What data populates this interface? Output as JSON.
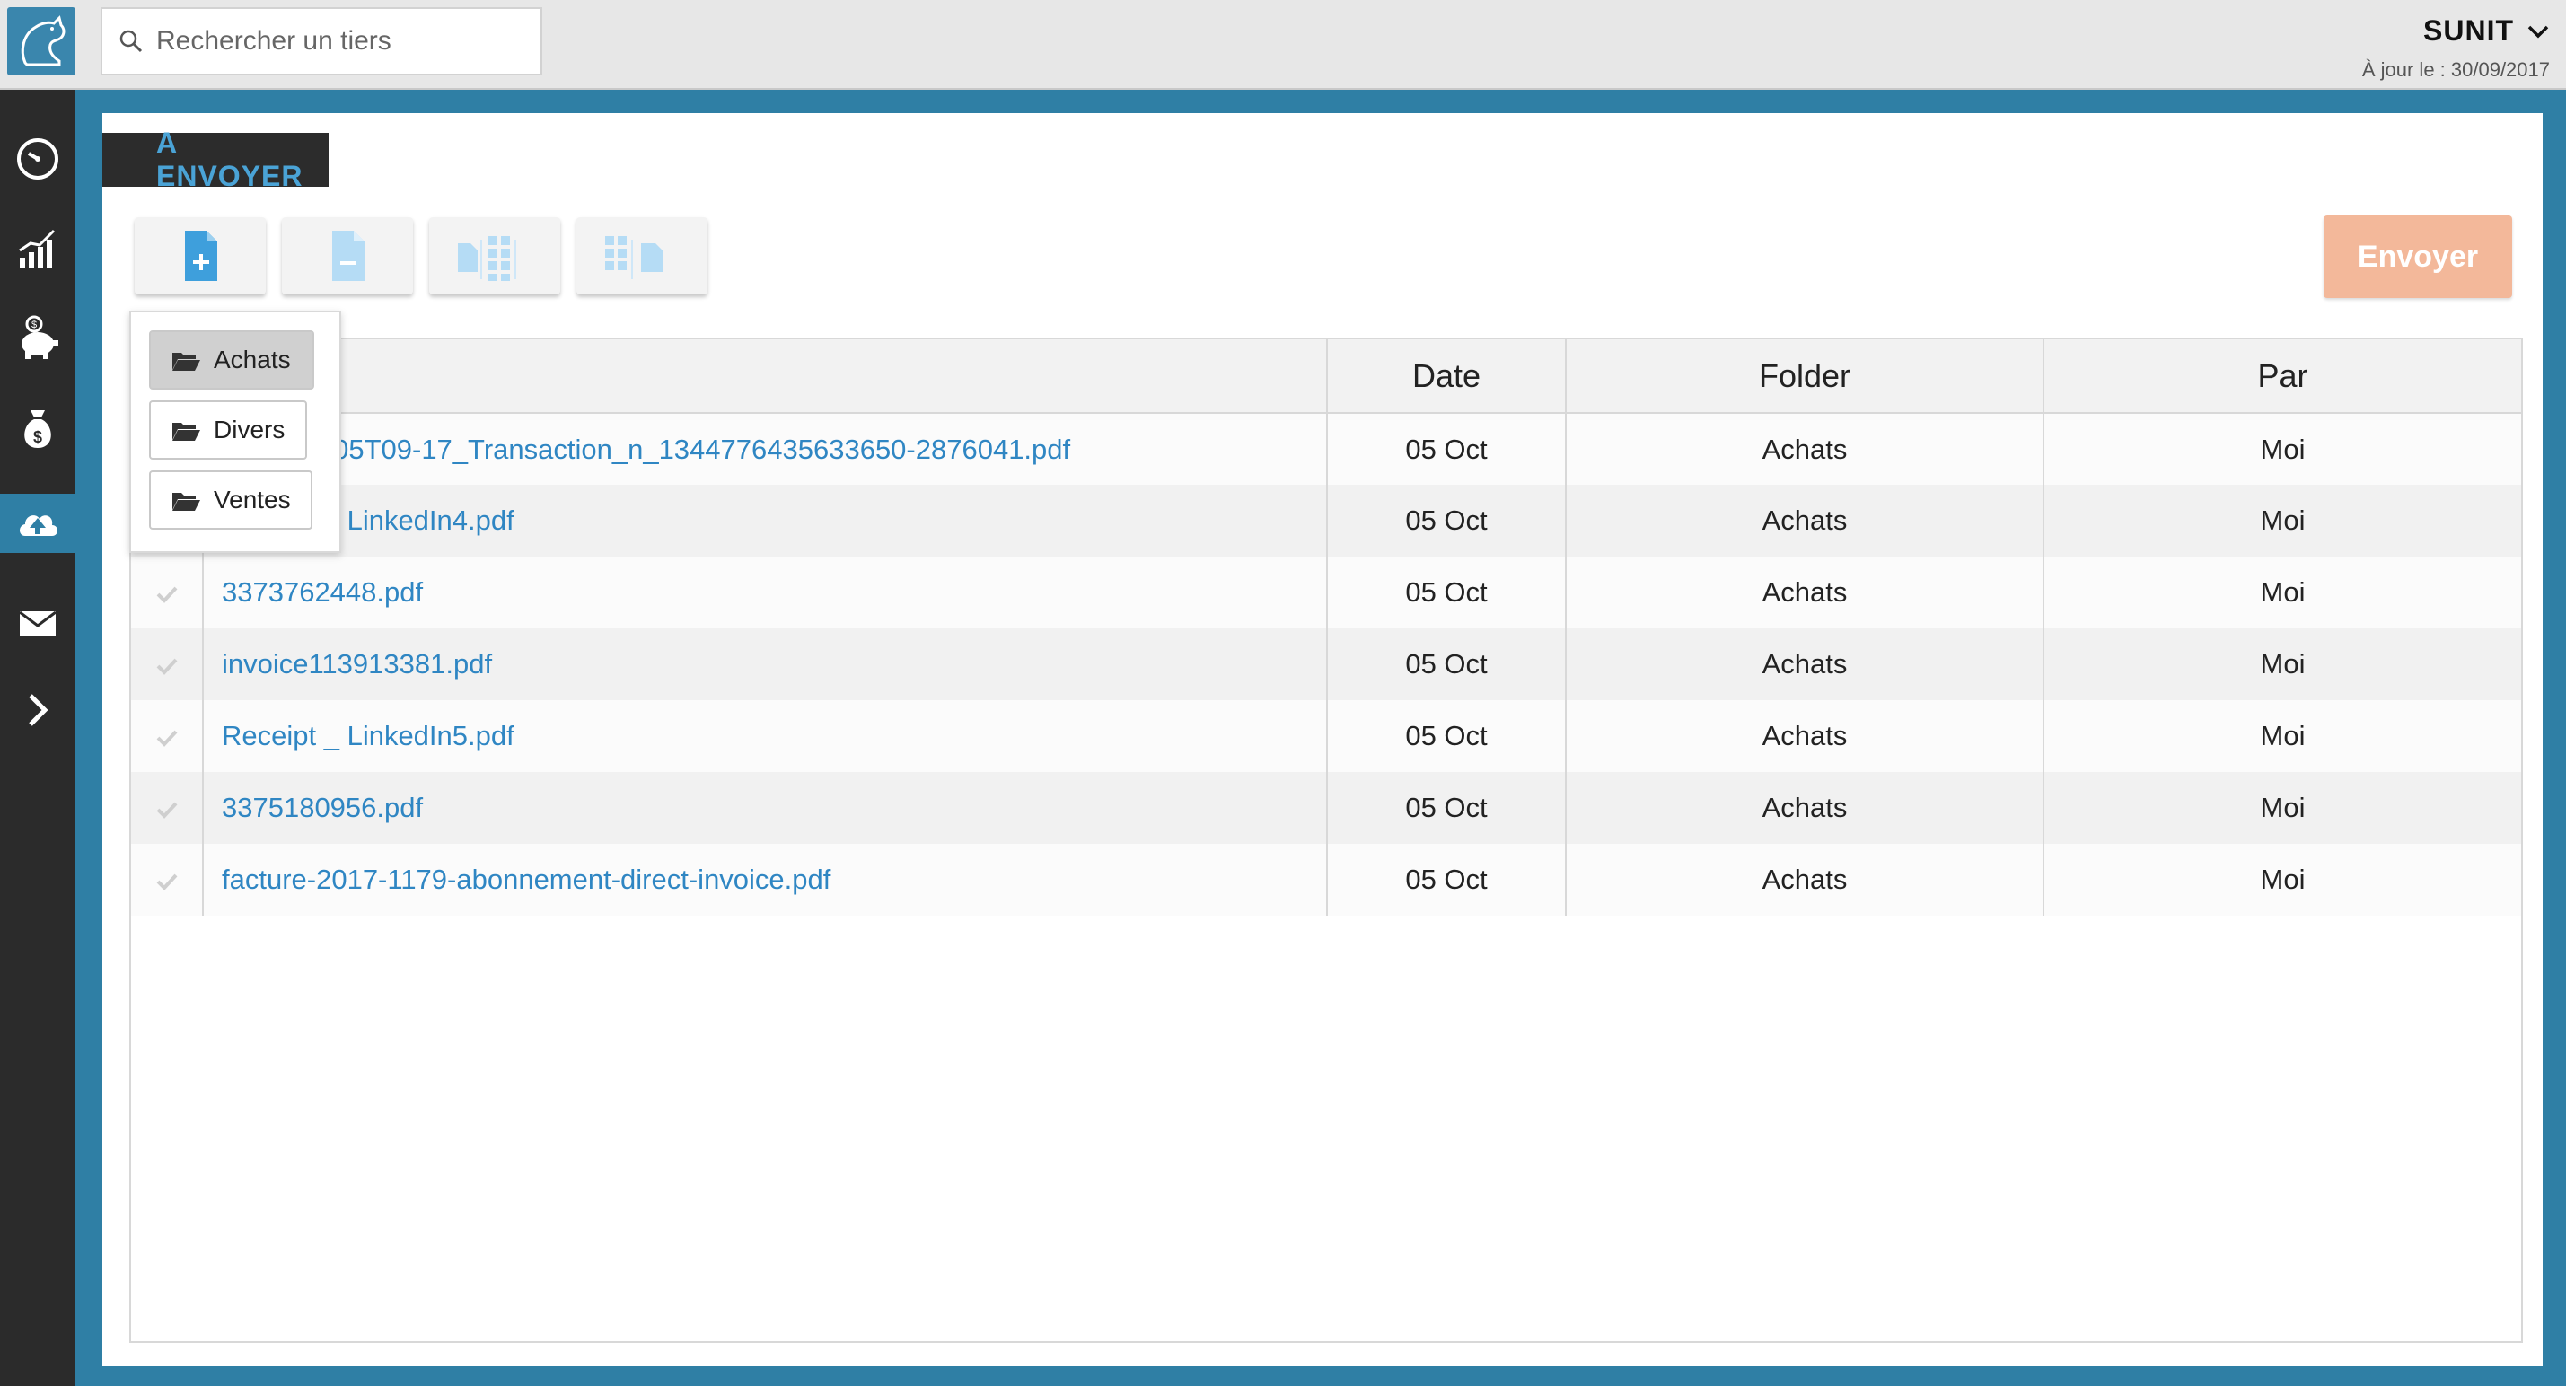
{
  "search": {
    "placeholder": "Rechercher un tiers"
  },
  "account": {
    "name": "SUNIT",
    "updated": "À jour le : 30/09/2017"
  },
  "sidebar": {
    "items": [
      {
        "icon": "dashboard-icon"
      },
      {
        "icon": "chart-icon"
      },
      {
        "icon": "piggy-bank-icon"
      },
      {
        "icon": "money-bag-icon"
      },
      {
        "icon": "cloud-upload-icon",
        "active": true
      },
      {
        "icon": "mail-icon"
      },
      {
        "icon": "chevron-right-icon"
      }
    ]
  },
  "section": {
    "title": "A ENVOYER"
  },
  "toolbar": {
    "add_icon": "add-file-icon",
    "remove_icon": "remove-file-icon",
    "merge_icon": "merge-file-icon",
    "split_icon": "split-file-icon",
    "send_label": "Envoyer"
  },
  "dropdown": {
    "items": [
      {
        "label": "Achats",
        "selected": true
      },
      {
        "label": "Divers"
      },
      {
        "label": "Ventes"
      }
    ]
  },
  "table": {
    "columns": [
      "",
      "",
      "Date",
      "Folder",
      "Par"
    ],
    "rows": [
      {
        "file": "2017-10-05T09-17_Transaction_n_1344776435633650-2876041.pdf",
        "date": "05 Oct",
        "folder": "Achats",
        "by": "Moi"
      },
      {
        "file": "Receipt _ LinkedIn4.pdf",
        "date": "05 Oct",
        "folder": "Achats",
        "by": "Moi"
      },
      {
        "file": "3373762448.pdf",
        "date": "05 Oct",
        "folder": "Achats",
        "by": "Moi"
      },
      {
        "file": "invoice113913381.pdf",
        "date": "05 Oct",
        "folder": "Achats",
        "by": "Moi"
      },
      {
        "file": "Receipt _ LinkedIn5.pdf",
        "date": "05 Oct",
        "folder": "Achats",
        "by": "Moi"
      },
      {
        "file": "3375180956.pdf",
        "date": "05 Oct",
        "folder": "Achats",
        "by": "Moi"
      },
      {
        "file": "facture-2017-1179-abonnement-direct-invoice.pdf",
        "date": "05 Oct",
        "folder": "Achats",
        "by": "Moi"
      }
    ]
  }
}
